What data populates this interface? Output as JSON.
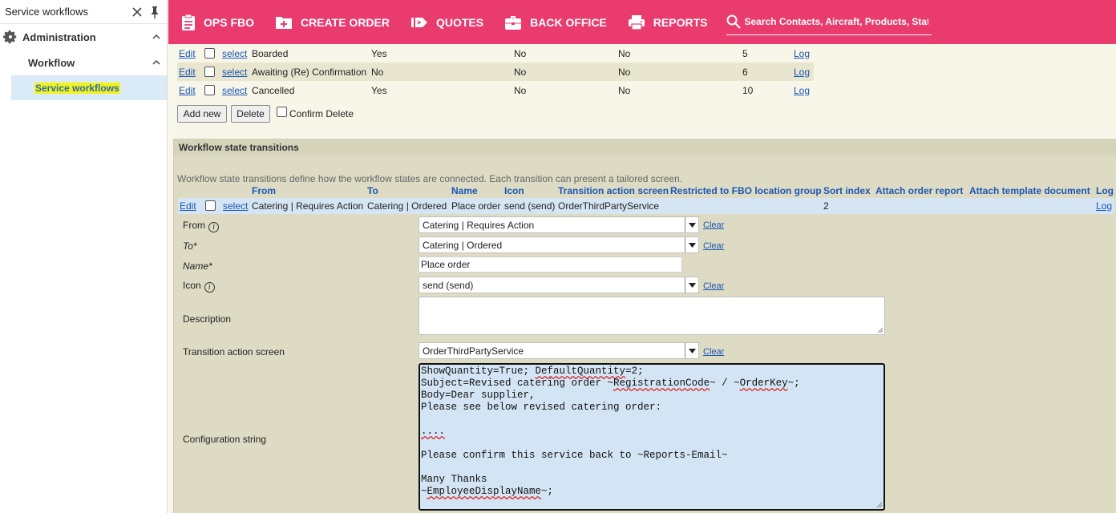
{
  "sidebar": {
    "header_title": "Service workflows",
    "nodes": [
      {
        "label": "Administration"
      },
      {
        "label": "Workflow"
      }
    ],
    "active_item": "Service workflows"
  },
  "nav": {
    "items": [
      {
        "label": "OPS FBO",
        "icon": "clipboard-icon"
      },
      {
        "label": "CREATE ORDER",
        "icon": "new-folder-icon"
      },
      {
        "label": "QUOTES",
        "icon": "tag-icon"
      },
      {
        "label": "BACK OFFICE",
        "icon": "briefcase-icon"
      },
      {
        "label": "REPORTS",
        "icon": "printer-icon"
      }
    ],
    "search_placeholder": "Search Contacts, Aircraft, Products, Stati..."
  },
  "states": {
    "rows": [
      {
        "edit": "Edit",
        "select": "select",
        "name": "Boarded",
        "c1": "Yes",
        "c2": "No",
        "c3": "No",
        "sort": "5",
        "log": "Log"
      },
      {
        "edit": "Edit",
        "select": "select",
        "name": "Awaiting (Re) Confirmation",
        "c1": "No",
        "c2": "No",
        "c3": "No",
        "sort": "6",
        "log": "Log"
      },
      {
        "edit": "Edit",
        "select": "select",
        "name": "Cancelled",
        "c1": "Yes",
        "c2": "No",
        "c3": "No",
        "sort": "10",
        "log": "Log"
      }
    ],
    "add_new": "Add new",
    "delete": "Delete",
    "confirm_delete": "Confirm Delete"
  },
  "transitions": {
    "title": "Workflow state transitions",
    "description": "Workflow state transitions define how the workflow states are connected. Each transition can present a tailored screen.",
    "headers": [
      "From",
      "To",
      "Name",
      "Icon",
      "Transition action screen",
      "Restricted to FBO location group",
      "Sort index",
      "Attach order report",
      "Attach template document",
      "Log"
    ],
    "row": {
      "edit": "Edit",
      "select": "select",
      "from": "Catering | Requires Action",
      "to": "Catering | Ordered",
      "name": "Place order",
      "icon": "send (send)",
      "screen": "OrderThirdPartyService",
      "sort": "2",
      "log": "Log"
    }
  },
  "form": {
    "from_label": "From",
    "from_value": "Catering | Requires Action",
    "to_label": "To*",
    "to_value": "Catering | Ordered",
    "name_label": "Name*",
    "name_value": "Place order",
    "icon_label": "Icon",
    "icon_value": "send (send)",
    "description_label": "Description",
    "screen_label": "Transition action screen",
    "screen_value": "OrderThirdPartyService",
    "config_label": "Configuration string",
    "clear": "Clear",
    "config_lines": [
      "ShowQuantity=True; DefaultQuantity=2;",
      "Subject=Revised catering order ~RegistrationCode~ / ~OrderKey~;",
      "Body=Dear supplier,",
      "Please see below revised catering order:",
      "",
      "....",
      "",
      "Please confirm this service back to ~Reports-Email~",
      "",
      "Many Thanks",
      "~EmployeeDisplayName~;"
    ]
  }
}
